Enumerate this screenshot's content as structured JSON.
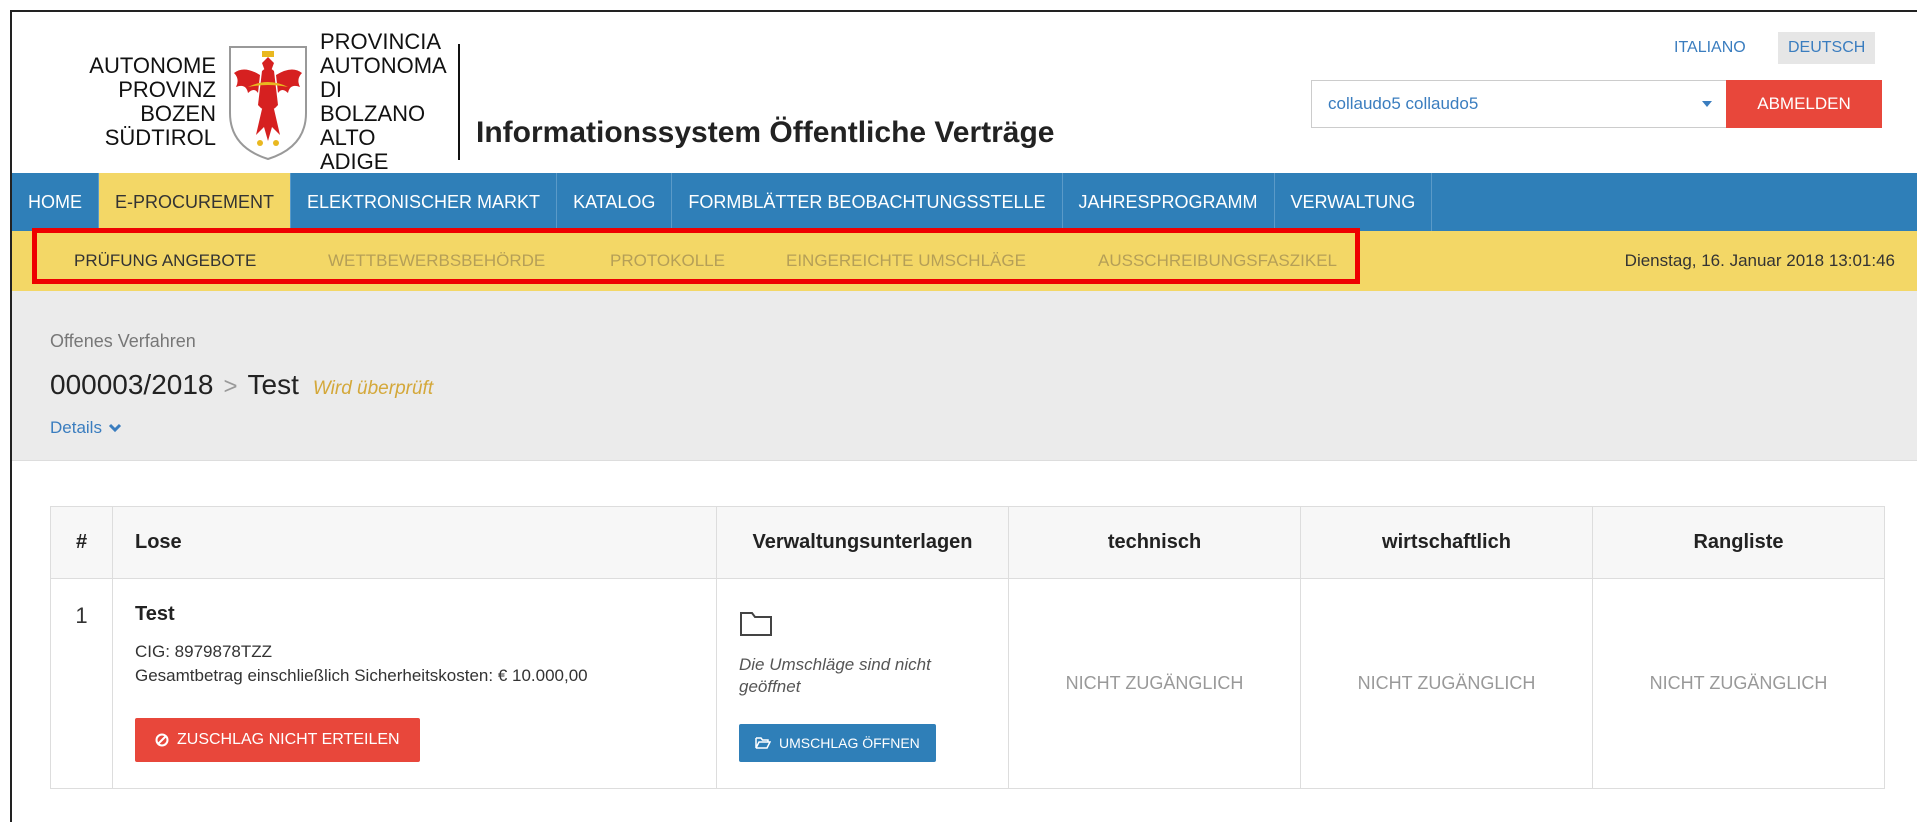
{
  "header": {
    "logo_de_lines": [
      "AUTONOME",
      "PROVINZ",
      "BOZEN",
      "SÜDTIROL"
    ],
    "logo_it_lines": [
      "PROVINCIA",
      "AUTONOMA",
      "DI BOLZANO",
      "ALTO ADIGE"
    ],
    "app_title": "Informationssystem Öffentliche Verträge",
    "lang_it": "ITALIANO",
    "lang_de": "DEUTSCH",
    "user": "collaudo5 collaudo5",
    "logout_label": "ABMELDEN"
  },
  "mainnav": {
    "items": [
      "HOME",
      "E-PROCUREMENT",
      "ELEKTRONISCHER MARKT",
      "KATALOG",
      "FORMBLÄTTER BEOBACHTUNGSSTELLE",
      "JAHRESPROGRAMM",
      "VERWALTUNG"
    ],
    "active_index": 1
  },
  "subnav": {
    "items": [
      "PRÜFUNG ANGEBOTE",
      "WETTBEWERBSBEHÖRDE",
      "PROTOKOLLE",
      "EINGEREICHTE UMSCHLÄGE",
      "AUSSCHREIBUNGSFASZIKEL"
    ],
    "active_index": 0,
    "datetime": "Dienstag, 16. Januar 2018 13:01:46"
  },
  "procedure": {
    "type": "Offenes Verfahren",
    "number": "000003/2018",
    "separator": ">",
    "name": "Test",
    "status": "Wird überprüft",
    "details_label": "Details"
  },
  "table": {
    "headers": [
      "#",
      "Lose",
      "Verwaltungsunterlagen",
      "technisch",
      "wirtschaftlich",
      "Rangliste"
    ],
    "rows": [
      {
        "num": "1",
        "lot_name": "Test",
        "cig": "CIG: 8979878TZZ",
        "amount": "Gesamtbetrag einschließlich Sicherheitskosten: € 10.000,00",
        "reject_label": "ZUSCHLAG NICHT ERTEILEN",
        "env_note": "Die Umschläge sind nicht geöffnet",
        "open_label": "UMSCHLAG ÖFFNEN",
        "technisch": "NICHT ZUGÄNGLICH",
        "wirtschaftlich": "NICHT ZUGÄNGLICH",
        "rangliste": "NICHT ZUGÄNGLICH"
      }
    ]
  },
  "colors": {
    "nav_blue": "#2f7fb8",
    "nav_yellow": "#f3d766",
    "danger_red": "#e8473b",
    "highlight_red": "#ee0000"
  },
  "icons": {
    "logo": "eagle-coat-of-arms",
    "user_dropdown": "caret-down-icon",
    "details": "chevron-down-icon",
    "reject": "ban-icon",
    "folder": "folder-icon",
    "open": "folder-open-icon"
  }
}
